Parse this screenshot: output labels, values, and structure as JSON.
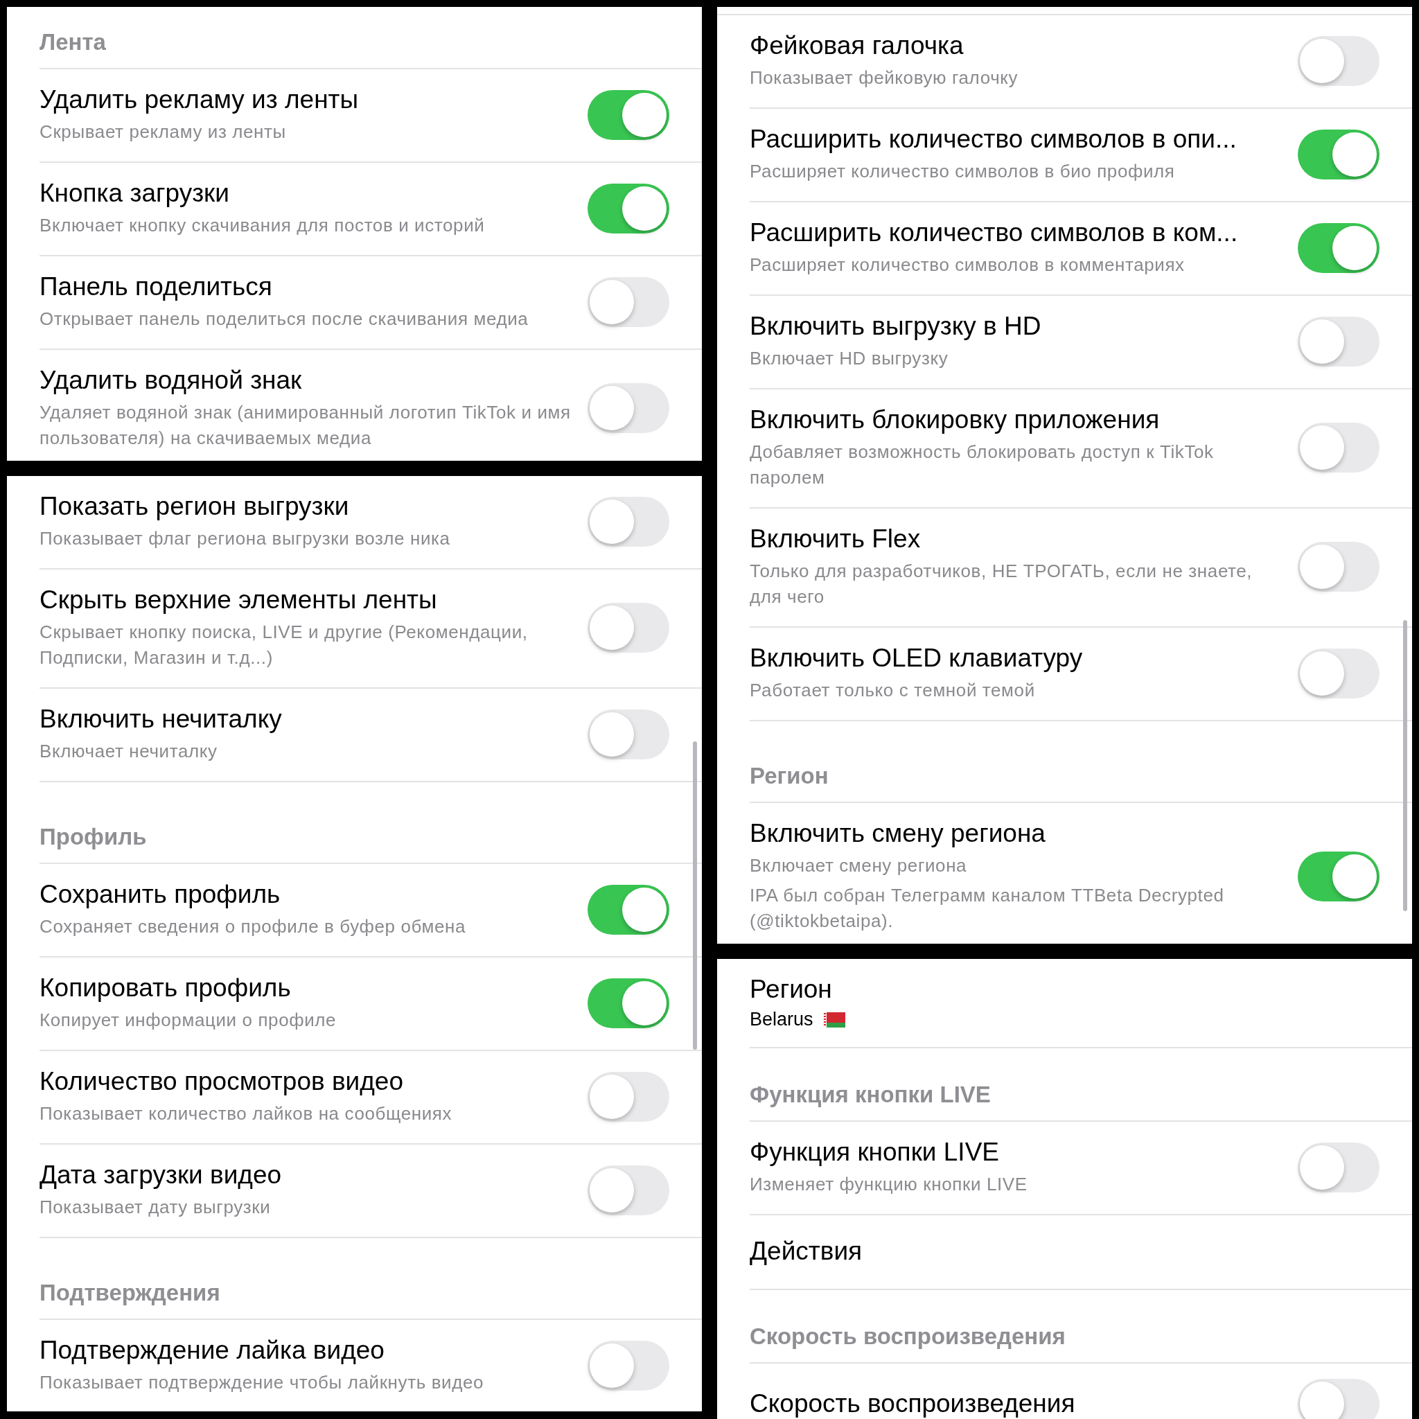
{
  "panels": [
    {
      "items": [
        {
          "kind": "section",
          "title": "Лента"
        },
        {
          "kind": "toggle",
          "title": "Удалить рекламу из ленты",
          "subtitle": "Скрывает рекламу из ленты",
          "on": true
        },
        {
          "kind": "toggle",
          "title": "Кнопка загрузки",
          "subtitle": "Включает кнопку скачивания для постов и историй",
          "on": true
        },
        {
          "kind": "toggle",
          "title": "Панель поделиться",
          "subtitle": "Открывает панель поделиться после скачивания медиа",
          "on": false
        },
        {
          "kind": "toggle",
          "title": "Удалить водяной знак",
          "subtitle": "Удаляет водяной знак (анимированный логотип TikTok и имя пользователя) на скачиваемых медиа",
          "on": false
        }
      ]
    },
    {
      "items": [
        {
          "kind": "toggle",
          "title": "Показать регион выгрузки",
          "subtitle": "Показывает флаг региона выгрузки возле ника",
          "on": false
        },
        {
          "kind": "toggle",
          "title": "Скрыть верхние элементы ленты",
          "subtitle": "Скрывает кнопку поиска, LIVE и другие (Рекомендации, Подписки, Магазин и т.д...)",
          "on": false
        },
        {
          "kind": "toggle",
          "title": "Включить нечиталку",
          "subtitle": "Включает нечиталку",
          "on": false
        },
        {
          "kind": "section",
          "title": "Профиль"
        },
        {
          "kind": "toggle",
          "title": "Сохранить профиль",
          "subtitle": "Сохраняет сведения о профиле в буфер обмена",
          "on": true
        },
        {
          "kind": "toggle",
          "title": "Копировать профиль",
          "subtitle": "Копирует информации о профиле",
          "on": true
        },
        {
          "kind": "toggle",
          "title": "Количество просмотров видео",
          "subtitle": "Показывает количество лайков на сообщениях",
          "on": false
        },
        {
          "kind": "toggle",
          "title": "Дата загрузки видео",
          "subtitle": "Показывает дату выгрузки",
          "on": false
        },
        {
          "kind": "section",
          "title": "Подтверждения"
        },
        {
          "kind": "toggle",
          "title": "Подтверждение лайка видео",
          "subtitle": "Показывает подтверждение чтобы лайкнуть видео",
          "on": false
        }
      ]
    },
    {
      "items": [
        {
          "kind": "toggle",
          "title": "Фейковая галочка",
          "subtitle": "Показывает фейковую галочку",
          "on": false
        },
        {
          "kind": "toggle",
          "title": "Расширить количество символов в опи...",
          "subtitle": "Расширяет количество символов в био профиля",
          "on": true
        },
        {
          "kind": "toggle",
          "title": "Расширить количество символов в ком...",
          "subtitle": "Расширяет количество символов в комментариях",
          "on": true
        },
        {
          "kind": "toggle",
          "title": "Включить выгрузку в HD",
          "subtitle": "Включает HD выгрузку",
          "on": false
        },
        {
          "kind": "toggle",
          "title": "Включить блокировку приложения",
          "subtitle": "Добавляет возможность блокировать доступ к TikTok паролем",
          "on": false
        },
        {
          "kind": "toggle",
          "title": "Включить Flex",
          "subtitle": "Только для разработчиков, НЕ ТРОГАТЬ, если не знаете, для чего",
          "on": false
        },
        {
          "kind": "toggle",
          "title": "Включить OLED клавиатуру",
          "subtitle": "Работает только с темной темой",
          "on": false
        },
        {
          "kind": "section",
          "title": "Регион"
        },
        {
          "kind": "toggle",
          "title": "Включить смену региона",
          "subtitle": "Включает смену региона",
          "note": "IPA был собран Телеграмм каналом TTBeta Decrypted (@tiktokbetaipa).",
          "on": true
        }
      ]
    },
    {
      "items": [
        {
          "kind": "value",
          "title": "Регион",
          "value": "Belarus"
        },
        {
          "kind": "section",
          "title": "Функция кнопки LIVE"
        },
        {
          "kind": "toggle",
          "title": "Функция кнопки LIVE",
          "subtitle": "Изменяет функцию кнопки LIVE",
          "on": false
        },
        {
          "kind": "action",
          "title": "Действия"
        },
        {
          "kind": "section",
          "title": "Скорость воспроизведения"
        },
        {
          "kind": "toggle",
          "title": "Скорость воспроизведения",
          "on": false
        }
      ]
    }
  ]
}
